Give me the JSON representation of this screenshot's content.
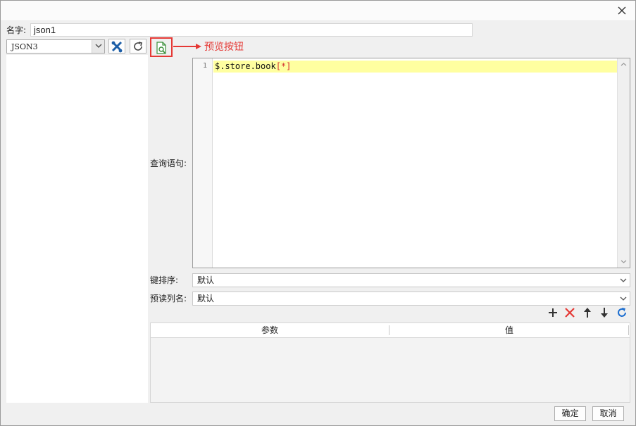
{
  "dialog": {
    "close_icon": "close-icon"
  },
  "name": {
    "label": "名字:",
    "value": "json1"
  },
  "datasource": {
    "selected": "JSON3"
  },
  "toolbar": {
    "edit_icon": "tools-icon",
    "refresh_icon": "refresh-icon",
    "preview_icon": "preview-document-icon"
  },
  "annotation": {
    "text": "预览按钮",
    "color": "#e53935"
  },
  "query": {
    "label": "查询语句:",
    "line_number": "1",
    "code_main": "$.store.book",
    "code_bracket": "[*]"
  },
  "key_sort": {
    "label": "键排序:",
    "value": "默认"
  },
  "preread": {
    "label": "预读列名:",
    "value": "默认"
  },
  "param_actions": [
    "add-icon",
    "delete-icon",
    "move-up-icon",
    "move-down-icon",
    "refresh-icon"
  ],
  "params_table": {
    "columns": [
      "参数",
      "值"
    ],
    "rows": []
  },
  "footer": {
    "ok_label": "确定",
    "cancel_label": "取消"
  },
  "colors": {
    "highlight": "#ffffa0",
    "delete": "#e53935",
    "refresh": "#1e6fd0"
  }
}
